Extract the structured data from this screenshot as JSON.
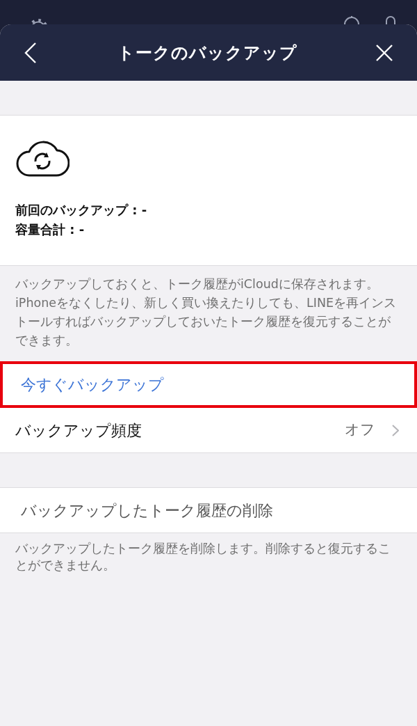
{
  "header": {
    "title": "トークのバックアップ"
  },
  "backup_info": {
    "last_backup": "前回のバックアップ : -",
    "total_size": "容量合計 : -"
  },
  "description": "バックアップしておくと、トーク履歴がiCloudに保存されます。iPhoneをなくしたり、新しく買い換えたりしても、LINEを再インストールすればバックアップしておいたトーク履歴を復元することができます。",
  "actions": [
    {
      "kind": "link",
      "label": "今すぐバックアップ",
      "highlighted": true
    },
    {
      "kind": "setting",
      "label": "バックアップ頻度",
      "value": "オフ",
      "highlighted": false
    }
  ],
  "delete_row": {
    "label": "バックアップしたトーク履歴の削除"
  },
  "delete_note": "バックアップしたトーク履歴を削除します。削除すると復元することができません。"
}
